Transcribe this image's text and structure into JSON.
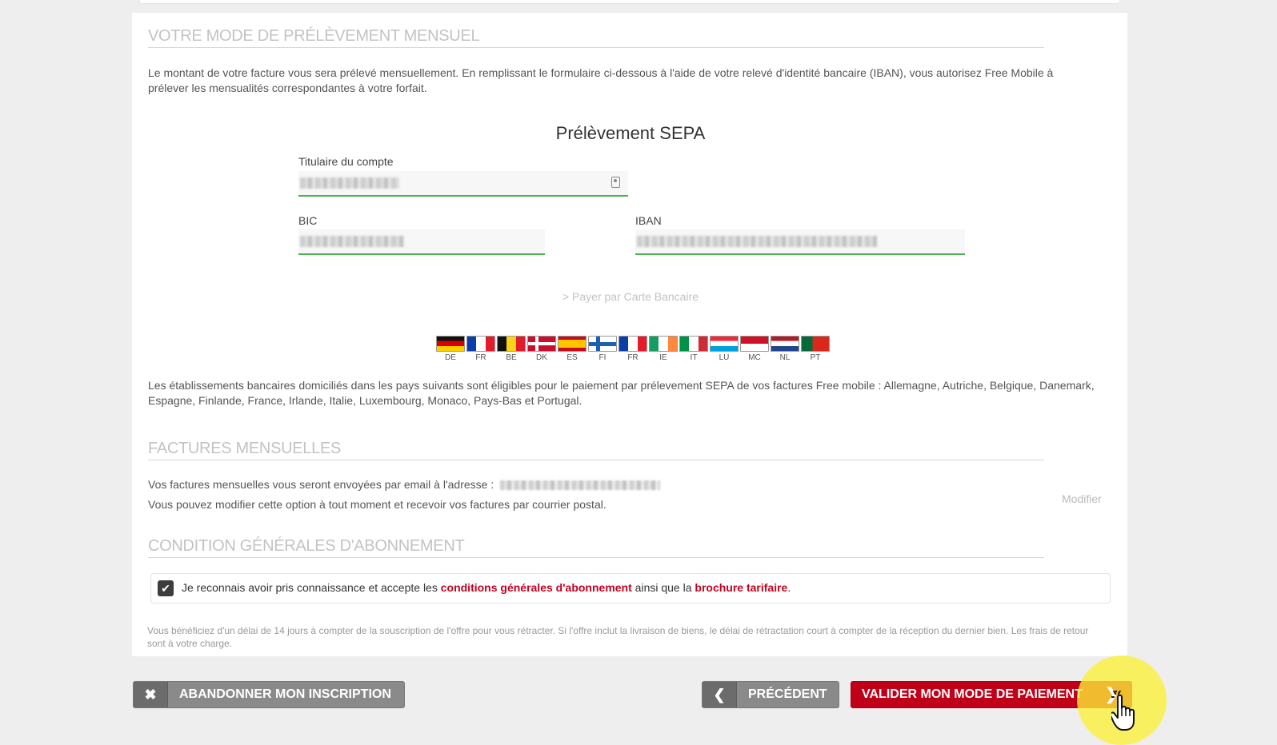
{
  "sections": {
    "prelevement": {
      "title": "VOTRE MODE DE PRÉLÈVEMENT MENSUEL",
      "intro": "Le montant de votre facture vous sera prélevé mensuellement. En remplissant le formulaire ci-dessous à l'aide de votre relevé d'identité bancaire (IBAN), vous autorisez Free Mobile à prélever les mensualités correspondantes à votre forfait.",
      "sepa_title": "Prélèvement SEPA",
      "fields": {
        "holder_label": "Titulaire du compte",
        "bic_label": "BIC",
        "iban_label": "IBAN"
      },
      "card_link": "> Payer par Carte Bancaire",
      "flags": [
        "DE",
        "FR",
        "BE",
        "DK",
        "ES",
        "FI",
        "FR",
        "IE",
        "IT",
        "LU",
        "MC",
        "NL",
        "PT"
      ],
      "eligibility": "Les établissements bancaires domiciliés dans les pays suivants sont éligibles pour le paiement par prélevement SEPA de vos factures Free mobile : Allemagne, Autriche, Belgique, Danemark, Espagne, Finlande, France, Irlande, Italie, Luxembourg, Monaco, Pays-Bas et Portugal."
    },
    "factures": {
      "title": "FACTURES MENSUELLES",
      "line1": "Vos factures mensuelles vous seront envoyées par email à l'adresse :",
      "line2": "Vous pouvez modifier cette option à tout moment et recevoir vos factures par courrier postal.",
      "modify_link": "Modifier"
    },
    "cgv": {
      "title": "CONDITION GÉNÉRALES D'ABONNEMENT",
      "checked": true,
      "text_before": "Je reconnais avoir pris connaissance et accepte les ",
      "link1": "conditions générales d'abonnement",
      "text_middle": " ainsi que la ",
      "link2": "brochure tarifaire",
      "text_after": ".",
      "retractation": "Vous bénéficiez d'un délai de 14 jours à compter de la souscription de l'offre pour vous rétracter. Si l'offre inclut la livraison de biens, le délai de rétractation court à compter de la réception du dernier bien. Les frais de retour sont à votre charge."
    }
  },
  "buttons": {
    "abandon": "ABANDONNER MON INSCRIPTION",
    "previous": "PRÉCÉDENT",
    "validate": "VALIDER MON MODE DE PAIEMENT"
  },
  "colors": {
    "accent_red": "#c00018",
    "field_border_green": "#4caf50",
    "button_grey": "#8a8a8a",
    "cursor_highlight": "#fcf137"
  }
}
